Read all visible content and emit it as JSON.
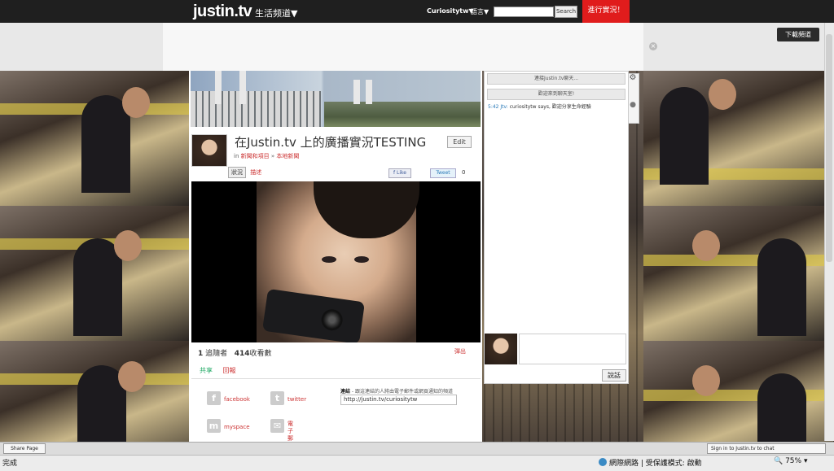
{
  "topbar": {
    "logo": "justin.tv",
    "channel_menu": "生活频道▼",
    "username": "Curiositytw▼",
    "language": "語言▼",
    "search_placeholder": "",
    "search_button": "Search",
    "go_live_button": "進行實況！",
    "brand_color": "#e01c1c"
  },
  "ad": {
    "close_icon": "close-icon",
    "download_button": "下載頻道"
  },
  "channel": {
    "title": "在Justin.tv 上的廣播實況TESTING",
    "edit_button": "Edit",
    "crumb_in": "in",
    "crumb_category": "新聞和項目",
    "crumb_sep": "»",
    "crumb_sub": "本地新聞",
    "tab_status": "狀況",
    "tab_info": "描述",
    "facebook_like": "f Like",
    "tweet": "Tweet",
    "tweet_count": "0"
  },
  "stats": {
    "followers_count": "1",
    "followers_label": "追隨者",
    "views_count": "414",
    "views_label": "收看數",
    "popout": "彈出"
  },
  "share": {
    "share_label": "共享",
    "report_label": "回報",
    "facebook": "facebook",
    "twitter": "twitter",
    "myspace": "myspace",
    "email": "電子郵",
    "embed_label_bold": "連結",
    "embed_label_rest": " - 跟這連結的人將由電子郵件或網頁通知的頻道",
    "embed_url": "http://justin.tv/curiositytw"
  },
  "chat": {
    "join_bar": "連接Justin.tv聊天...",
    "welcome_bar": "歡迎來到聊天室!",
    "msg_time": "5:42",
    "msg_user": "Jtv:",
    "msg_text": "curiositytw says, 歡迎分享生命經驗",
    "send_button": "說話"
  },
  "bottom": {
    "share_page": "Share Page",
    "signin": "Sign in to Justin.tv to chat"
  },
  "status": {
    "done": "完成",
    "zone": "網際網路 | 受保護模式: 啟動",
    "zoom": "75%"
  }
}
